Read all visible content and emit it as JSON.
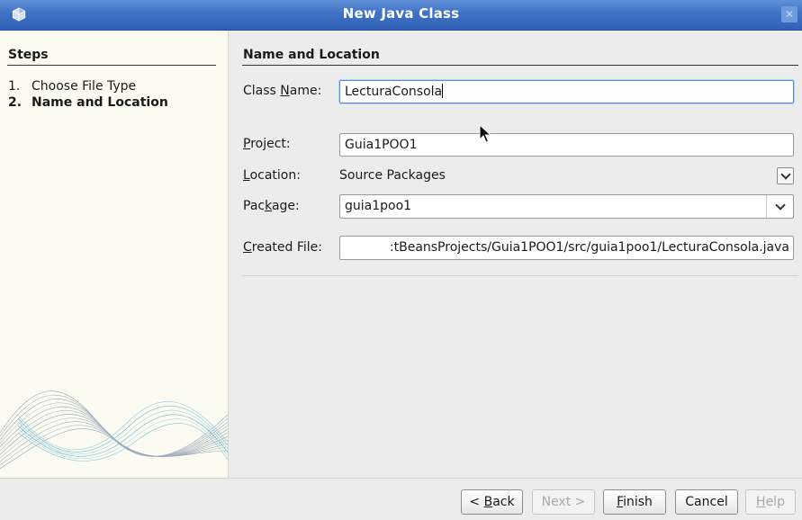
{
  "window": {
    "title": "New Java Class",
    "close_icon": "close-icon",
    "app_icon": "netbeans-cube-icon"
  },
  "steps": {
    "heading": "Steps",
    "items": [
      {
        "number": "1.",
        "label": "Choose File Type",
        "current": false
      },
      {
        "number": "2.",
        "label": "Name and Location",
        "current": true
      }
    ]
  },
  "form": {
    "section_title": "Name and Location",
    "class_name": {
      "label_pre": "Class ",
      "label_mnemonic": "N",
      "label_post": "ame:",
      "value": "LecturaConsola"
    },
    "project": {
      "label_pre": "",
      "label_mnemonic": "P",
      "label_post": "roject:",
      "value": "Guia1POO1"
    },
    "location": {
      "label_pre": "",
      "label_mnemonic": "L",
      "label_post": "ocation:",
      "value": "Source Packages"
    },
    "package": {
      "label_pre": "Pac",
      "label_mnemonic": "k",
      "label_post": "age:",
      "value": "guia1poo1"
    },
    "created_file": {
      "label_pre": "",
      "label_mnemonic": "C",
      "label_post": "reated File:",
      "value": ":tBeansProjects/Guia1POO1/src/guia1poo1/LecturaConsola.java"
    }
  },
  "buttons": {
    "back": {
      "pre": "< ",
      "mnemonic": "B",
      "post": "ack",
      "enabled": true
    },
    "next": {
      "pre": "Next >",
      "mnemonic": "",
      "post": "",
      "enabled": false
    },
    "finish": {
      "pre": "",
      "mnemonic": "F",
      "post": "inish",
      "enabled": true
    },
    "cancel": {
      "pre": "Cancel",
      "mnemonic": "",
      "post": "",
      "enabled": true
    },
    "help": {
      "pre": "",
      "mnemonic": "H",
      "post": "elp",
      "enabled": false
    }
  },
  "colors": {
    "title_bar": "#3f72c4",
    "steps_background": "#fbfbf1",
    "dialog_background": "#ececec",
    "focus_border": "#5d8ad0"
  }
}
